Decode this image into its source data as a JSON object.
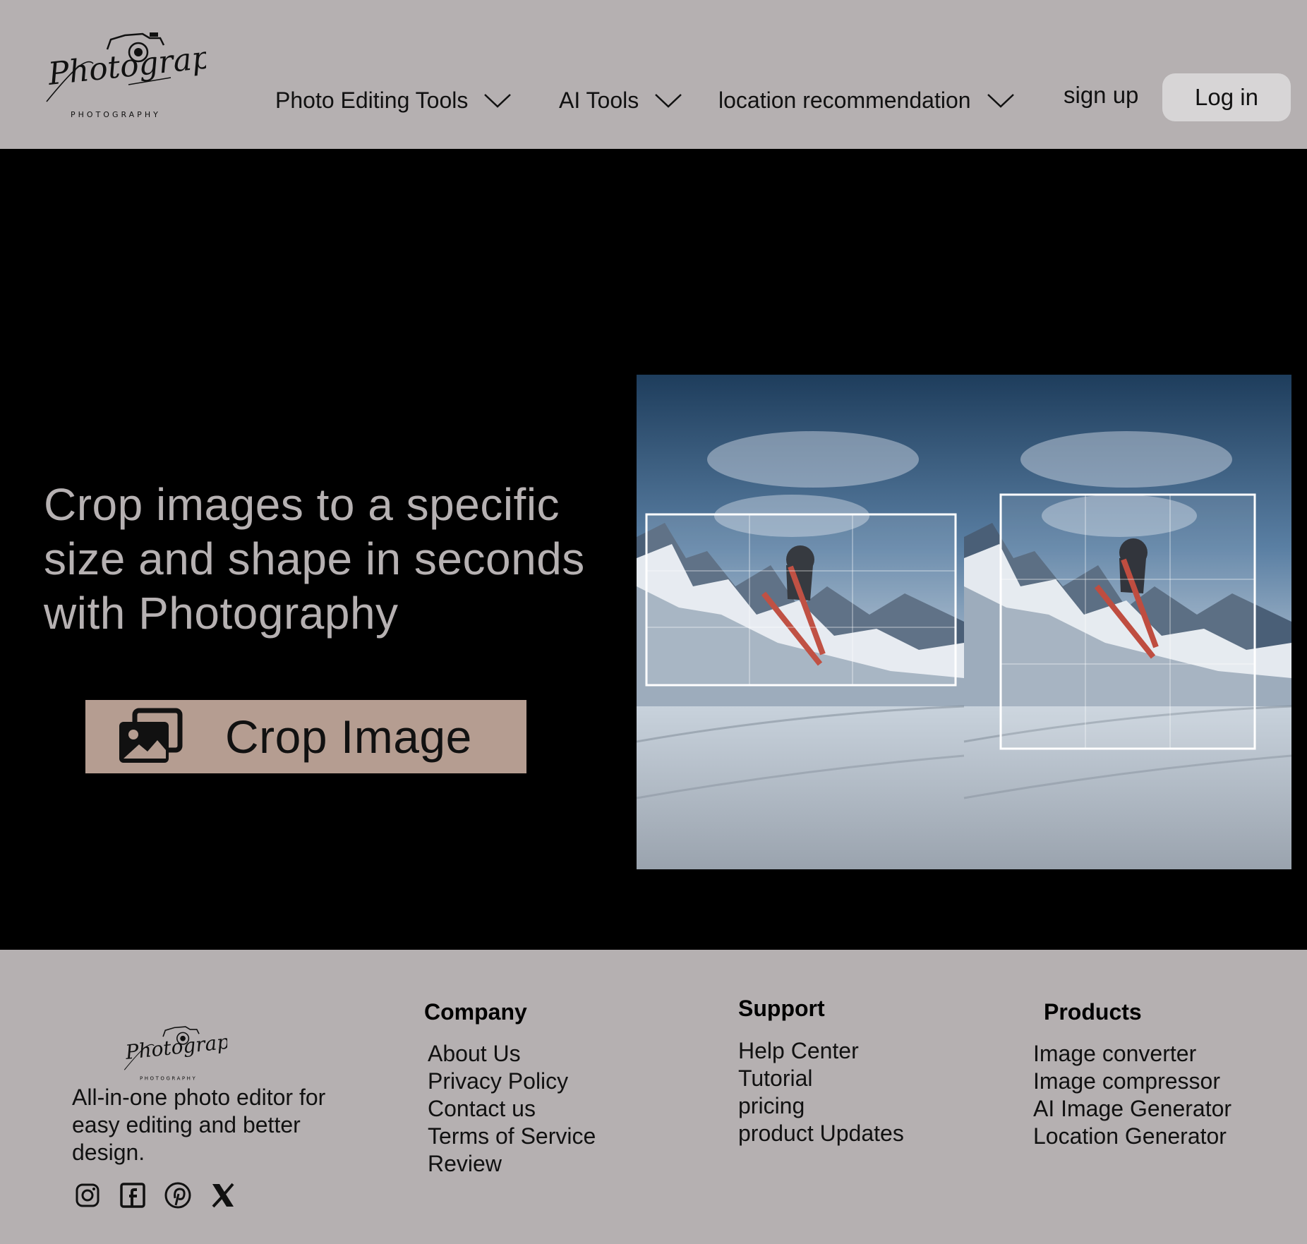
{
  "header": {
    "logo_alt": "Photography",
    "nav": [
      {
        "label": "Photo Editing Tools"
      },
      {
        "label": "AI Tools"
      },
      {
        "label": "location recommendation"
      }
    ],
    "signup_label": "sign up",
    "login_label": "Log in"
  },
  "hero": {
    "headline": "Crop images to a specific size and shape in seconds with Photography",
    "cta_label": "Crop Image",
    "cta_icon": "images-icon",
    "preview_alt": "Before and after crop of a skier jumping over snowy mountains"
  },
  "footer": {
    "logo_alt": "Photography",
    "tagline": "All-in-one photo editor for easy editing and better design.",
    "socials": [
      "instagram-icon",
      "facebook-icon",
      "pinterest-icon",
      "x-icon"
    ],
    "columns": [
      {
        "title": "Company",
        "links": [
          "About Us",
          "Privacy Policy",
          "Contact us",
          "Terms of Service",
          "Review"
        ]
      },
      {
        "title": "Support",
        "links": [
          "Help Center",
          "Tutorial",
          "pricing",
          "product Updates"
        ]
      },
      {
        "title": "Products",
        "links": [
          "Image converter",
          "Image compressor",
          "AI Image Generator",
          "Location Generator"
        ]
      }
    ]
  },
  "colors": {
    "background": "#b5b0b1",
    "hero_background": "#000000",
    "headline": "#b6b1b2",
    "cta_background": "#b59d91",
    "login_background": "#d7d5d6"
  }
}
